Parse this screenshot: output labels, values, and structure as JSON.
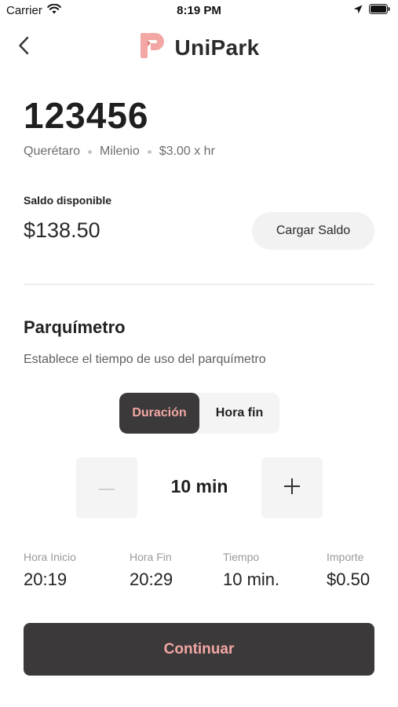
{
  "status_bar": {
    "carrier": "Carrier",
    "time": "8:19 PM"
  },
  "header": {
    "app_name": "UniPark",
    "brand_color": "#f2a7a4"
  },
  "location": {
    "plate": "123456",
    "city": "Querétaro",
    "zone": "Milenio",
    "rate": "$3.00 x hr"
  },
  "balance": {
    "label": "Saldo disponible",
    "amount": "$138.50",
    "load_button": "Cargar Saldo"
  },
  "parking": {
    "title": "Parquímetro",
    "description": "Establece el tiempo de uso del parquímetro",
    "tabs": [
      {
        "label": "Duración",
        "active": true
      },
      {
        "label": "Hora fin",
        "active": false
      }
    ],
    "duration": "10 min"
  },
  "summary": [
    {
      "label": "Hora Inicio",
      "value": "20:19"
    },
    {
      "label": "Hora Fin",
      "value": "20:29"
    },
    {
      "label": "Tiempo",
      "value": "10 min."
    },
    {
      "label": "Importe",
      "value": "$0.50"
    }
  ],
  "continue_button": "Continuar",
  "icons": [
    "wifi-icon",
    "location-arrow-icon",
    "battery-icon",
    "back-chevron-icon",
    "unipark-logo-icon",
    "minus-icon",
    "plus-icon"
  ]
}
